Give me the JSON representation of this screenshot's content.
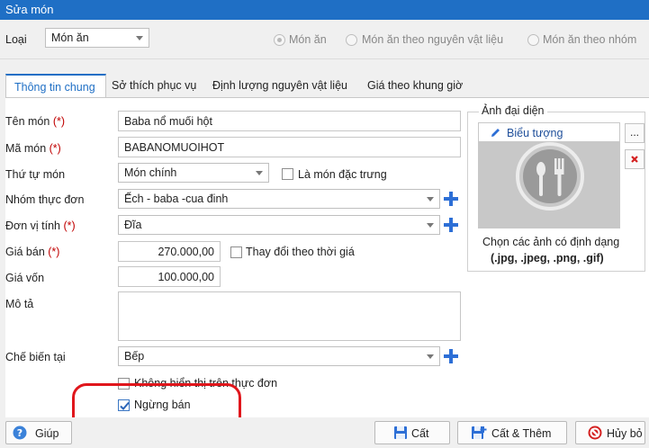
{
  "window": {
    "title": "Sửa món"
  },
  "type_bar": {
    "label": "Loại",
    "selected": "Món ăn",
    "radios": [
      {
        "label": "Món ăn",
        "checked": true
      },
      {
        "label": "Món ăn theo nguyên vật liệu",
        "checked": false
      },
      {
        "label": "Món ăn theo nhóm",
        "checked": false
      }
    ]
  },
  "tabs": [
    {
      "label": "Thông tin chung",
      "active": true
    },
    {
      "label": "Sở thích phục vụ",
      "active": false
    },
    {
      "label": "Định lượng nguyên vật liệu",
      "active": false
    },
    {
      "label": "Giá theo khung giờ",
      "active": false
    }
  ],
  "form": {
    "required_mark": "(*)",
    "name": {
      "label": "Tên món",
      "value": "Baba nổ muối hột"
    },
    "code": {
      "label": "Mã món",
      "value": "BABANOMUOIHOT"
    },
    "order": {
      "label": "Thứ tự món",
      "value": "Món chính"
    },
    "signature": {
      "label": "Là món đặc trưng",
      "checked": false
    },
    "menu_group": {
      "label": "Nhóm thực đơn",
      "value": "Ếch - baba -cua đinh"
    },
    "unit": {
      "label": "Đơn vị tính",
      "value": "Đĩa"
    },
    "price": {
      "label": "Giá bán",
      "value": "270.000,00"
    },
    "market_price": {
      "label": "Thay đổi theo thời giá",
      "checked": false
    },
    "cost": {
      "label": "Giá vốn",
      "value": "100.000,00"
    },
    "description": {
      "label": "Mô tả",
      "value": ""
    },
    "kitchen": {
      "label": "Chế biến tại",
      "value": "Bếp"
    },
    "hide_on_menu": {
      "label": "Không hiển thị trên thực đơn",
      "checked": false
    },
    "stop_selling": {
      "label": "Ngừng bán",
      "checked": true
    }
  },
  "avatar": {
    "group_title": "Ảnh đại diện",
    "icon_button": "Biểu tượng",
    "more_button": "...",
    "hint_line1": "Chọn các ảnh có định dạng",
    "hint_line2": "(.jpg, .jpeg, .png, .gif)"
  },
  "buttons": {
    "help": "Giúp",
    "save": "Cất",
    "save_add": "Cất & Thêm",
    "cancel": "Hủy bỏ"
  },
  "colors": {
    "title_bar": "#1f6fc5",
    "required": "#c00000",
    "highlight": "#e0161c",
    "plus": "#2d6fd6"
  }
}
